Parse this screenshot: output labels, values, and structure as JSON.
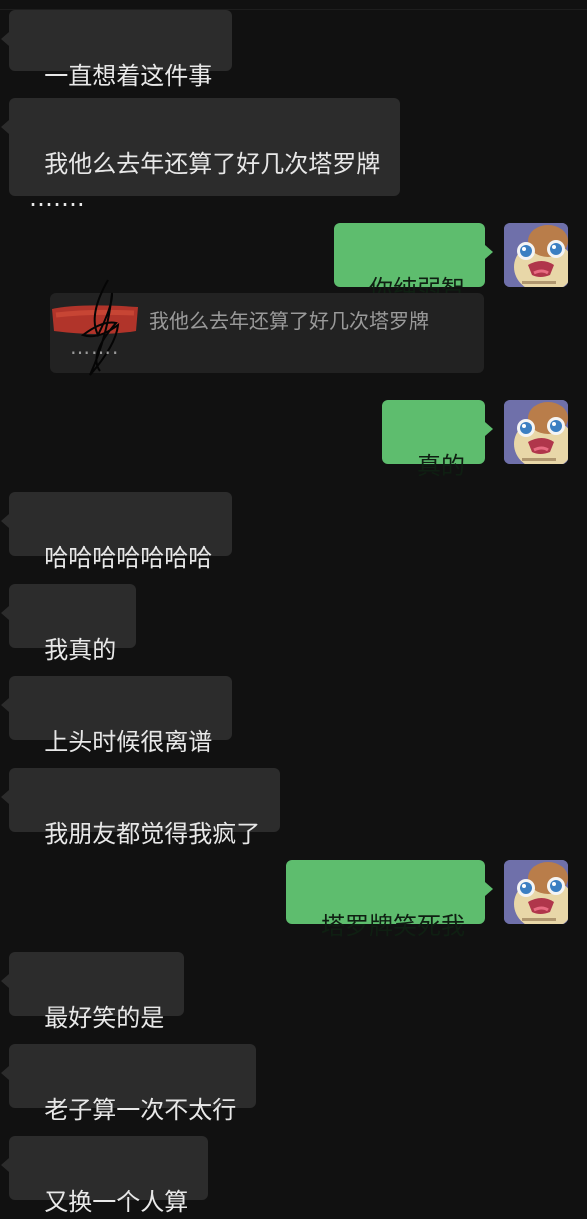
{
  "colors": {
    "background": "#111111",
    "bubble_incoming": "#2c2c2c",
    "bubble_outgoing": "#5ebd6e",
    "quote_background": "#222222"
  },
  "messages": [
    {
      "side": "left",
      "text": "一直想着这件事"
    },
    {
      "side": "left",
      "text": "我他么去年还算了好几次塔罗牌\n……."
    },
    {
      "side": "right",
      "text": "你纯弱智"
    },
    {
      "side": "right",
      "text": "真的"
    },
    {
      "side": "left",
      "text": "哈哈哈哈哈哈哈"
    },
    {
      "side": "left",
      "text": "我真的"
    },
    {
      "side": "left",
      "text": "上头时候很离谱"
    },
    {
      "side": "left",
      "text": "我朋友都觉得我疯了"
    },
    {
      "side": "right",
      "text": "塔罗牌笑死我"
    },
    {
      "side": "left",
      "text": "最好笑的是"
    },
    {
      "side": "left",
      "text": "老子算一次不太行"
    },
    {
      "side": "left",
      "text": "又换一个人算"
    }
  ],
  "quote": {
    "text": "我他么去年还算了好几次塔罗牌",
    "continuation": "……."
  },
  "avatar": {
    "icon": "cartoon-avatar-icon"
  }
}
